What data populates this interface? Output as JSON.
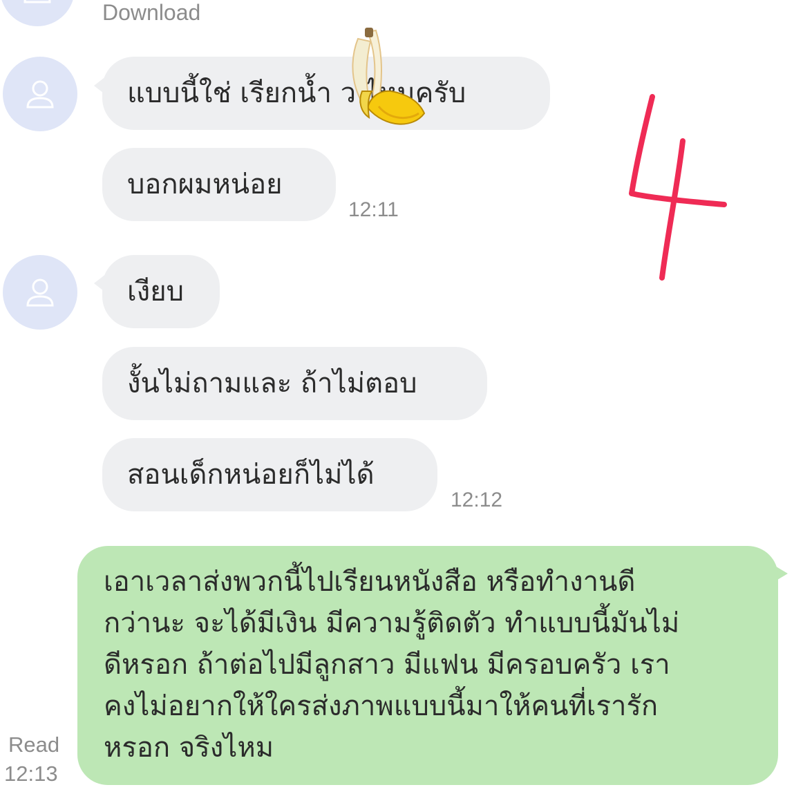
{
  "top": {
    "download_label": "Download"
  },
  "messages": [
    {
      "text": "แบบนี้ใช่ เรียกน้ำ ว ไหมครับ"
    },
    {
      "text": "บอกผมหน่อย",
      "time": "12:11"
    },
    {
      "text": "เงียบ"
    },
    {
      "text": "งั้นไม่ถามและ  ถ้าไม่ตอบ"
    },
    {
      "text": "สอนเด็กหน่อยก็ไม่ได้",
      "time": "12:12"
    }
  ],
  "reply": {
    "lines": [
      "เอาเวลาส่งพวกนี้ไปเรียนหนังสือ หรือทำงานดี",
      "กว่านะ จะได้มีเงิน มีความรู้ติดตัว ทำแบบนี้มันไม่",
      "ดีหรอก ถ้าต่อไปมีลูกสาว มีแฟน มีครอบครัว เรา",
      "คงไม่อยากให้ใครส่งภาพแบบนี้มาให้คนที่เรารัก",
      "หรอก จริงไหม"
    ],
    "read_label": "Read",
    "time": "12:13"
  },
  "icons": {
    "avatar": "default-person-icon",
    "sticker": "banana-emoji",
    "annotation": "handwritten-number-4"
  },
  "colors": {
    "incoming_bubble": "#eeeff1",
    "outgoing_bubble": "#bde7b5",
    "avatar_bg": "#dfe5f7",
    "annotation": "#ef2b55"
  }
}
